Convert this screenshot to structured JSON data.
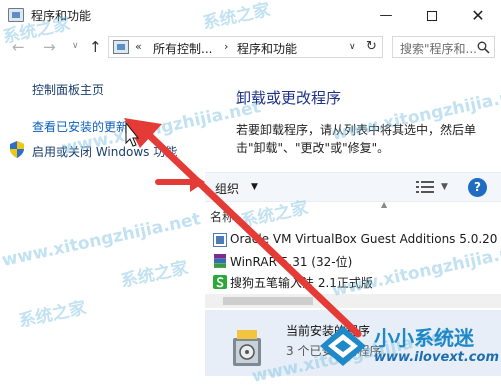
{
  "window": {
    "title": "程序和功能",
    "minimize_label": "—",
    "close_label": "✕"
  },
  "nav": {
    "back_label": "←",
    "forward_label": "→",
    "recent_label": "∨",
    "up_label": "↑"
  },
  "address": {
    "separator": "«",
    "crumb1": "所有控制...",
    "crumb_arrow": "›",
    "crumb2": "程序和功能",
    "dropdown_label": "∨",
    "refresh_label": "↻"
  },
  "search": {
    "placeholder": "搜索\"程序和..."
  },
  "sidebar": {
    "home": "控制面板主页",
    "updates": "查看已安装的更新",
    "features": "启用或关闭 Windows 功能"
  },
  "main": {
    "heading": "卸载或更改程序",
    "description": "若要卸载程序，请从列表中将其选中，然后单击\"卸载\"、\"更改\"或\"修复\"。"
  },
  "toolbar": {
    "organize_label": "组织",
    "organize_drop": "▼",
    "view_drop": "▼",
    "help_label": "?"
  },
  "list": {
    "column_name": "名称",
    "sort_indicator": "▲",
    "rows": [
      {
        "name": "Oracle VM VirtualBox Guest Additions 5.0.20",
        "icon": "virtualbox-icon"
      },
      {
        "name": "WinRAR 5.31 (32-位)",
        "icon": "winrar-icon"
      },
      {
        "name": "搜狗五笔输入法 2.1正式版",
        "icon": "sogou-icon"
      }
    ]
  },
  "details": {
    "title": "当前安装的程序",
    "count": "3 个已安装的程序"
  },
  "watermark": {
    "site_cn": "系统之家",
    "site_url": "www.xitongzhijia.net"
  },
  "brand": {
    "name": "小小系统迷",
    "url": "www.ilovext.com"
  },
  "colors": {
    "link": "#0b5fb8",
    "heading": "#1e3287",
    "arrow": "#e53b36",
    "details_bg": "#e7eef7",
    "brand": "#1e88c8"
  }
}
